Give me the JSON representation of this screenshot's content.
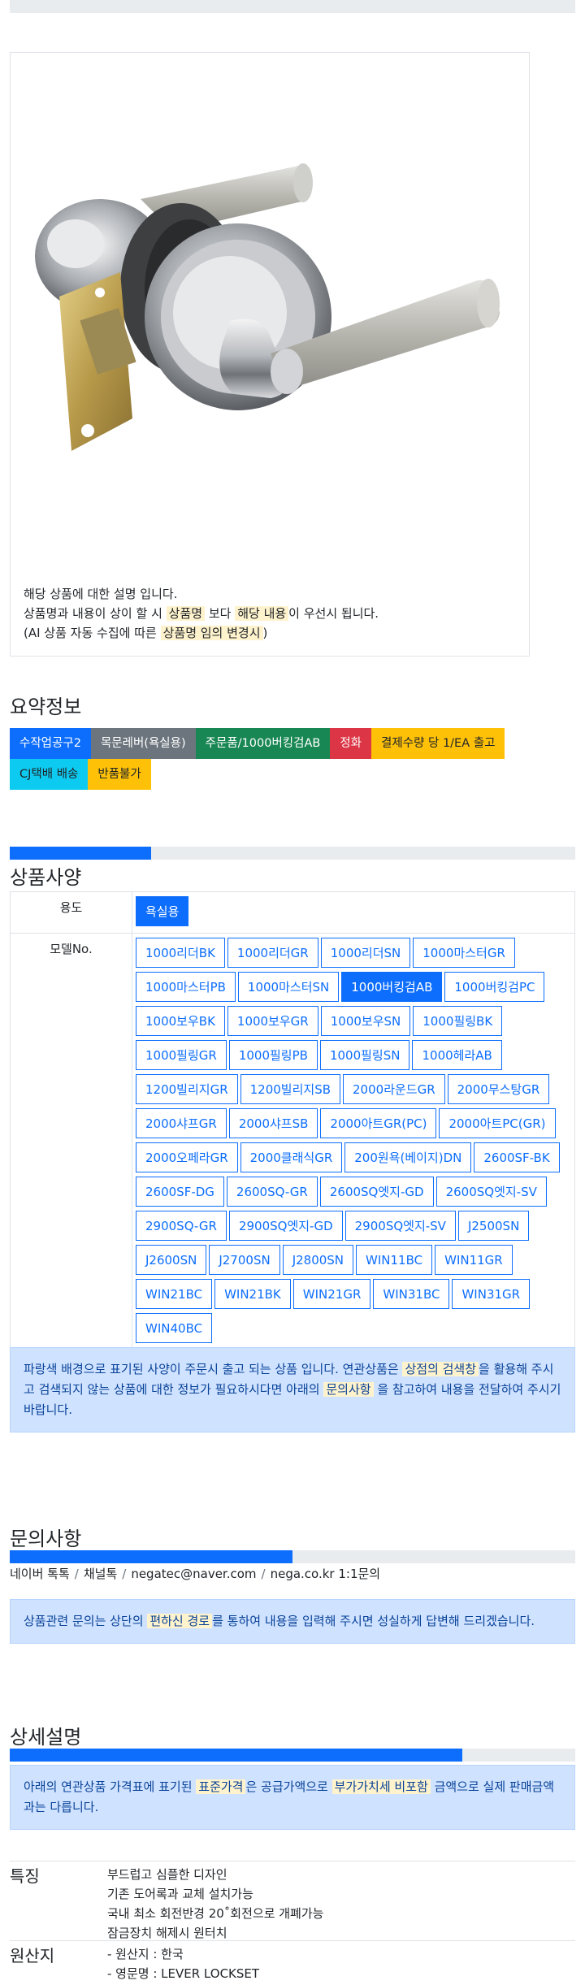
{
  "product": {
    "image_alt": "도어락 레버 손잡이",
    "desc_line1": "해당 상품에 대한 설명 입니다.",
    "desc_line2_pre": "상품명과 내용이 상이 할 시 ",
    "desc_line2_hl1": "상품명",
    "desc_line2_mid": " 보다 ",
    "desc_line2_hl2": "해당 내용",
    "desc_line2_post": "이 우선시 됩니다.",
    "desc_line3_pre": "(AI 상품 자동 수집에 따른 ",
    "desc_line3_hl": "상품명 임의 변경시",
    "desc_line3_post": ")"
  },
  "summary": {
    "title": "요약정보",
    "badges": [
      {
        "label": "수작업공구2",
        "style": "primary"
      },
      {
        "label": "목문레버(욕실용)",
        "style": "secondary"
      },
      {
        "label": "주문품/1000버킹검AB",
        "style": "success"
      },
      {
        "label": "정화",
        "style": "danger"
      },
      {
        "label": "결제수량 당 1/EA 출고",
        "style": "warning"
      },
      {
        "label": "CJ택배 배송",
        "style": "info"
      },
      {
        "label": "반품불가",
        "style": "warning"
      }
    ]
  },
  "spec": {
    "progress_percent": 25,
    "title": "상품사양",
    "usage_label": "용도",
    "usage_options": [
      "욕실용"
    ],
    "model_label": "모델No.",
    "model_options": [
      "1000리더BK",
      "1000리더GR",
      "1000리더SN",
      "1000마스터GR",
      "1000마스터PB",
      "1000마스터SN",
      "1000버킹검AB",
      "1000버킹검PC",
      "1000보우BK",
      "1000보우GR",
      "1000보우SN",
      "1000필링BK",
      "1000필링GR",
      "1000필링PB",
      "1000필링SN",
      "1000헤라AB",
      "1200빌리지GR",
      "1200빌리지SB",
      "2000라운드GR",
      "2000무스탕GR",
      "2000샤프GR",
      "2000샤프SB",
      "2000아트GR(PC)",
      "2000아트PC(GR)",
      "2000오페라GR",
      "2000클래식GR",
      "200원욕(베이지)DN",
      "2600SF-BK",
      "2600SF-DG",
      "2600SQ-GR",
      "2600SQ엣지-GD",
      "2600SQ엣지-SV",
      "2900SQ-GR",
      "2900SQ엣지-GD",
      "2900SQ엣지-SV",
      "J2500SN",
      "J2600SN",
      "J2700SN",
      "J2800SN",
      "WIN11BC",
      "WIN11GR",
      "WIN21BC",
      "WIN21BK",
      "WIN21GR",
      "WIN31BC",
      "WIN31GR",
      "WIN40BC"
    ],
    "model_selected": "1000버킹검AB",
    "notice_pre": "파랑색 배경으로 표기된 사양이 주문시 출고 되는 상품 입니다. 연관상품은 ",
    "notice_hl1": "상점의 검색창",
    "notice_mid": "을 활용해 주시고 검색되지 않는 상품에 대한 정보가 필요하시다면 아래의 ",
    "notice_hl2": "문의사항",
    "notice_post": " 을 참고하여 내용을 전달하여 주시기 바랍니다."
  },
  "inquiry": {
    "title": "문의사항",
    "progress_percent": 50,
    "contacts": [
      "네이버 톡톡",
      "채널톡",
      "negatec@naver.com",
      "nega.co.kr 1:1문의"
    ],
    "notice_pre": "상품관련 문의는 상단의 ",
    "notice_hl": "편하신 경로",
    "notice_post": "를 통하여 내용을 입력해 주시면 성실하게 답변해 드리겠습니다."
  },
  "detail": {
    "title": "상세설명",
    "progress_percent": 80,
    "notice_pre": "아래의 연관상품 가격표에 표기된 ",
    "notice_hl1": "표준가격",
    "notice_mid": "은 공급가액으로 ",
    "notice_hl2": "부가가치세 비포함",
    "notice_post": " 금액으로 실제 판매금액과는 다릅니다.",
    "features_label": "특징",
    "features": [
      "부드럽고 심플한 디자인",
      "기존 도어록과 교체 설치가능",
      "국내 최소 회전반경 20˚회전으로 개폐가능",
      "잠금장치 해제시 원터치"
    ],
    "origin_label": "원산지",
    "origin": [
      "- 원산지 : 한국",
      "- 영문명 : LEVER LOCKSET"
    ]
  },
  "colors": {
    "primary": "#0d6efd",
    "highlight": "#fff3cd",
    "alert_bg": "#cfe2ff"
  }
}
